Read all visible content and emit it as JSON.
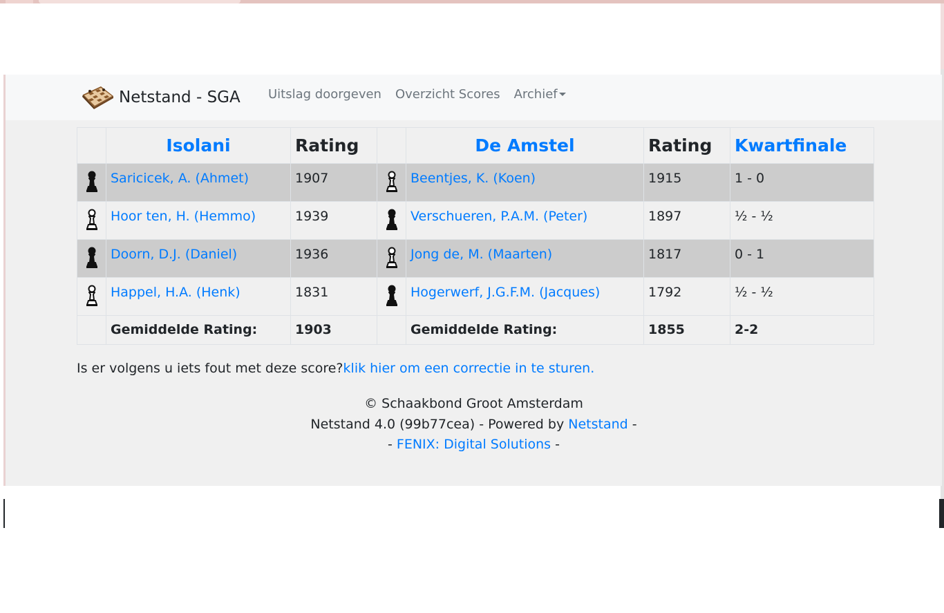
{
  "navbar": {
    "brand": "Netstand - SGA",
    "links": [
      {
        "label": "Uitslag doorgeven"
      },
      {
        "label": "Overzicht Scores"
      },
      {
        "label": "Archief"
      }
    ]
  },
  "table": {
    "home_team": "Isolani",
    "away_team": "De Amstel",
    "rating_header": "Rating",
    "round": "Kwartfinale",
    "rows": [
      {
        "home_color": "black",
        "home_player": "Saricicek, A. (Ahmet)",
        "home_rating": "1907",
        "away_color": "white",
        "away_player": "Beentjes, K. (Koen)",
        "away_rating": "1915",
        "result": "1 - 0"
      },
      {
        "home_color": "white",
        "home_player": "Hoor ten, H. (Hemmo)",
        "home_rating": "1939",
        "away_color": "black",
        "away_player": "Verschueren, P.A.M. (Peter)",
        "away_rating": "1897",
        "result": "½ - ½"
      },
      {
        "home_color": "black",
        "home_player": "Doorn, D.J. (Daniel)",
        "home_rating": "1936",
        "away_color": "white",
        "away_player": "Jong de, M. (Maarten)",
        "away_rating": "1817",
        "result": "0 - 1"
      },
      {
        "home_color": "white",
        "home_player": "Happel, H.A. (Henk)",
        "home_rating": "1831",
        "away_color": "black",
        "away_player": "Hogerwerf, J.G.F.M. (Jacques)",
        "away_rating": "1792",
        "result": "½ - ½"
      }
    ],
    "total": {
      "label": "Gemiddelde Rating:",
      "home_avg": "1903",
      "away_avg": "1855",
      "score": "2-2"
    }
  },
  "correction": {
    "text": "Is er volgens u iets fout met deze score?",
    "link": "klik hier om een correctie in te sturen."
  },
  "footer": {
    "copyright": "© Schaakbond Groot Amsterdam",
    "version_prefix": "Netstand 4.0 (99b77cea) - Powered by ",
    "netstand_link": "Netstand",
    "version_suffix": " -",
    "fenix_prefix": "- ",
    "fenix_link": "FENIX: Digital Solutions",
    "fenix_suffix": " -"
  },
  "icons": {
    "brand": "chessboard-logo-icon",
    "pawn_black": "black-pawn-icon",
    "pawn_white": "white-pawn-icon"
  }
}
